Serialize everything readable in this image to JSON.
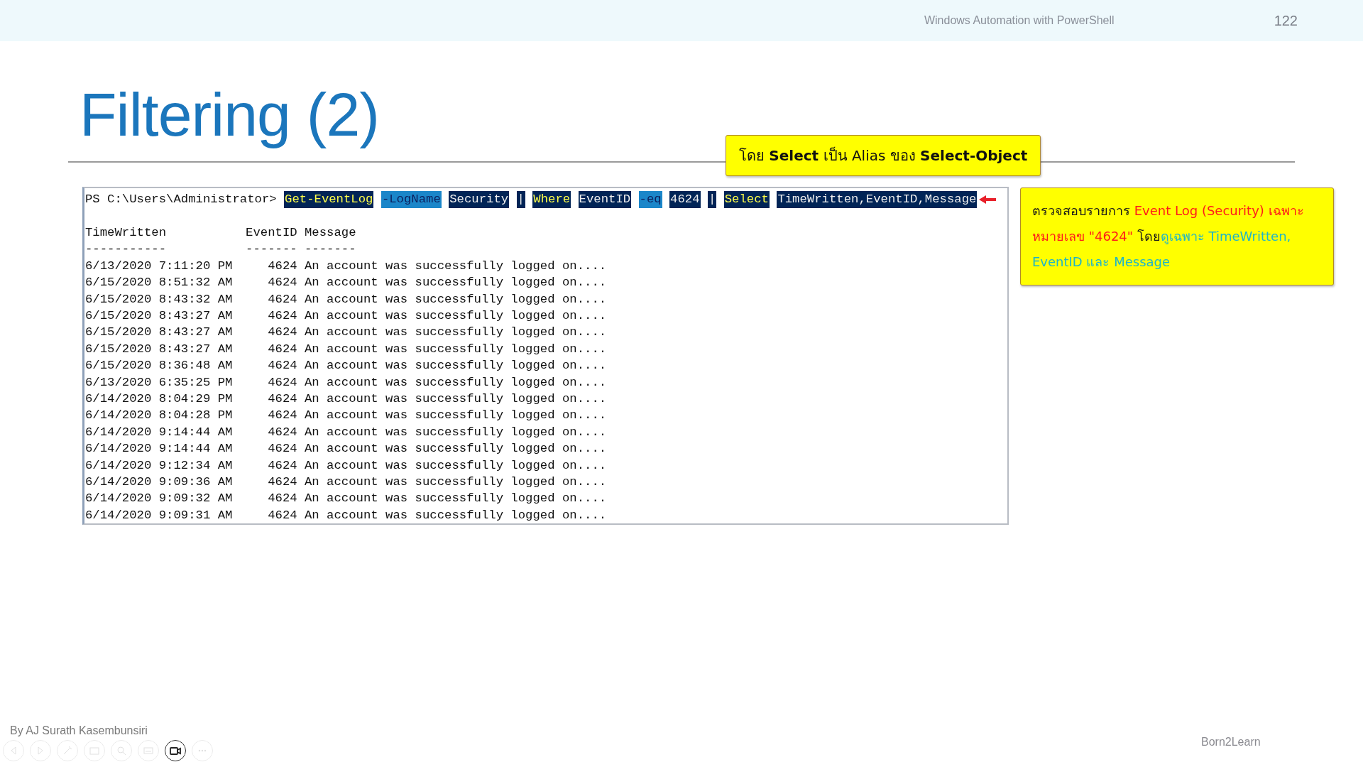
{
  "header": {
    "course": "Windows Automation with PowerShell",
    "page": "122"
  },
  "title": "Filtering (2)",
  "alias_note": "โดย **Select** เป็น Alias ของ **Select-Object**",
  "console": {
    "prompt": "PS C:\\Users\\Administrator>",
    "tokens": [
      {
        "text": "Get-EventLog",
        "kind": "cmdlet"
      },
      {
        "text": "-LogName",
        "kind": "param"
      },
      {
        "text": "Security",
        "kind": "arg"
      },
      {
        "text": "|",
        "kind": "arg"
      },
      {
        "text": "Where",
        "kind": "cmdlet"
      },
      {
        "text": "EventID",
        "kind": "arg"
      },
      {
        "text": "-eq",
        "kind": "param"
      },
      {
        "text": "4624",
        "kind": "arg"
      },
      {
        "text": "|",
        "kind": "arg"
      },
      {
        "text": "Select",
        "kind": "cmdlet"
      },
      {
        "text": "TimeWritten,EventID,Message",
        "kind": "arg"
      }
    ],
    "columns": [
      "TimeWritten",
      "EventID",
      "Message"
    ],
    "underlines": [
      "-----------",
      "-------",
      "-------"
    ],
    "rows": [
      [
        "6/13/2020 7:11:20 PM",
        "4624",
        "An account was successfully logged on...."
      ],
      [
        "6/15/2020 8:51:32 AM",
        "4624",
        "An account was successfully logged on...."
      ],
      [
        "6/15/2020 8:43:32 AM",
        "4624",
        "An account was successfully logged on...."
      ],
      [
        "6/15/2020 8:43:27 AM",
        "4624",
        "An account was successfully logged on...."
      ],
      [
        "6/15/2020 8:43:27 AM",
        "4624",
        "An account was successfully logged on...."
      ],
      [
        "6/15/2020 8:43:27 AM",
        "4624",
        "An account was successfully logged on...."
      ],
      [
        "6/15/2020 8:36:48 AM",
        "4624",
        "An account was successfully logged on...."
      ],
      [
        "6/13/2020 6:35:25 PM",
        "4624",
        "An account was successfully logged on...."
      ],
      [
        "6/14/2020 8:04:29 PM",
        "4624",
        "An account was successfully logged on...."
      ],
      [
        "6/14/2020 8:04:28 PM",
        "4624",
        "An account was successfully logged on...."
      ],
      [
        "6/14/2020 9:14:44 AM",
        "4624",
        "An account was successfully logged on...."
      ],
      [
        "6/14/2020 9:14:44 AM",
        "4624",
        "An account was successfully logged on...."
      ],
      [
        "6/14/2020 9:12:34 AM",
        "4624",
        "An account was successfully logged on...."
      ],
      [
        "6/14/2020 9:09:36 AM",
        "4624",
        "An account was successfully logged on...."
      ],
      [
        "6/14/2020 9:09:32 AM",
        "4624",
        "An account was successfully logged on...."
      ],
      [
        "6/14/2020 9:09:31 AM",
        "4624",
        "An account was successfully logged on...."
      ]
    ]
  },
  "explanation": [
    {
      "text": "ตรวจสอบรายการ ",
      "color": "#1a1a1a"
    },
    {
      "text": "Event Log (Security) เฉพาะหมายเลข \"4624\"",
      "color": "#ff1a1a"
    },
    {
      "text": " โดย",
      "color": "#1a1a1a"
    },
    {
      "text": "ดูเฉพาะ TimeWritten, EventID และ Message",
      "color": "#1fb5c8"
    }
  ],
  "footer": {
    "author": "By AJ Surath Kasembunsiri",
    "brand": "Born2Learn"
  }
}
